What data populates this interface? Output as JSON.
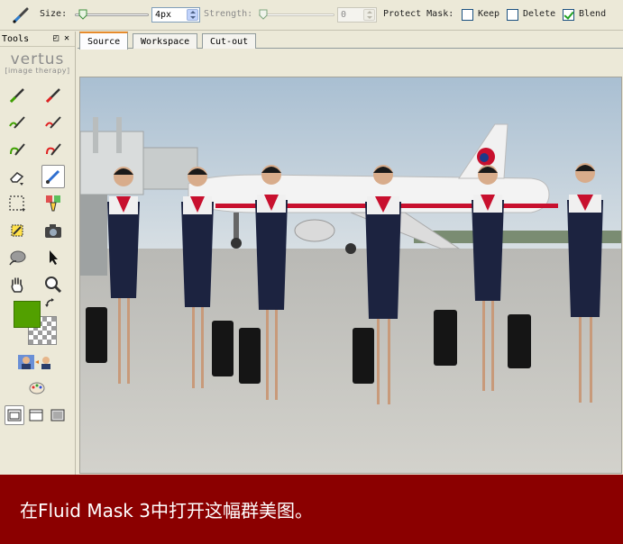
{
  "toolbar": {
    "size_label": "Size:",
    "size_value": "4px",
    "strength_label": "Strength:",
    "strength_value": "0",
    "protect_mask_label": "Protect Mask:",
    "keep_label": "Keep",
    "keep_checked": false,
    "delete_label": "Delete",
    "delete_checked": false,
    "blend_label": "Blend",
    "blend_checked": true,
    "brush_icon": "brush-icon"
  },
  "tools_panel": {
    "title": "Tools",
    "logo_text": "vertus",
    "logo_subtext": "[image therapy]",
    "foreground_color": "#52a000",
    "icons": [
      "green-brush-icon",
      "red-brush-icon",
      "green-detail-brush-icon",
      "red-detail-brush-icon",
      "green-spiral-brush-icon",
      "red-spiral-brush-icon",
      "eraser-icon",
      "edit-pen-icon",
      "marquee-select-icon",
      "fill-bucket-icon",
      "magic-wand-icon",
      "camera-icon",
      "blob-icon",
      "arrow-pointer-icon",
      "hand-icon",
      "zoom-icon",
      "swap-colors-icon",
      "people-preview-icon",
      "paint-palette-icon",
      "view-single-icon",
      "view-window-icon",
      "view-full-icon"
    ]
  },
  "tabs": [
    {
      "label": "Source",
      "active": true
    },
    {
      "label": "Workspace",
      "active": false
    },
    {
      "label": "Cut-out",
      "active": false
    }
  ],
  "caption": {
    "text": "在Fluid Mask 3中打开这幅群美图。"
  },
  "colors": {
    "caption_bg": "#8b0000",
    "panel_bg": "#ece9d8",
    "tab_accent": "#e68b2c"
  }
}
